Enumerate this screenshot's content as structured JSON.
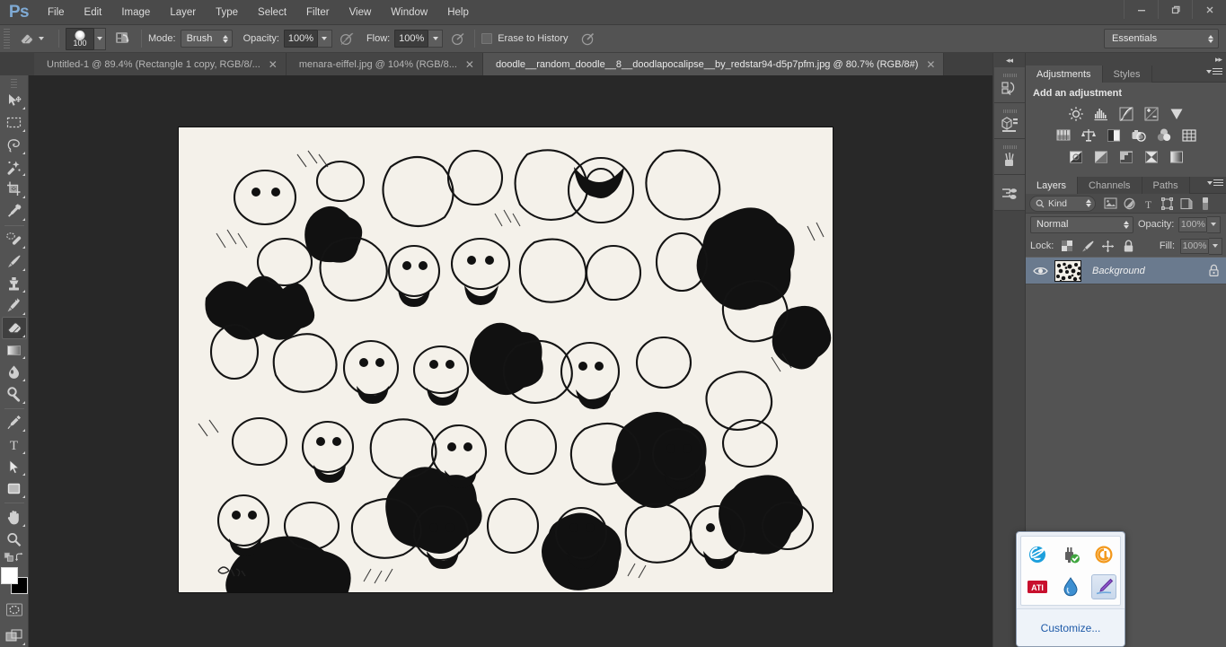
{
  "app": {
    "name": "Ps",
    "logo_color": "#7faad4",
    "workspace": "Essentials"
  },
  "menubar": {
    "items": [
      {
        "label": "File"
      },
      {
        "label": "Edit"
      },
      {
        "label": "Image"
      },
      {
        "label": "Layer"
      },
      {
        "label": "Type"
      },
      {
        "label": "Select"
      },
      {
        "label": "Filter"
      },
      {
        "label": "View"
      },
      {
        "label": "Window"
      },
      {
        "label": "Help"
      }
    ],
    "window_controls": [
      {
        "name": "minimize-button",
        "glyph": "—"
      },
      {
        "name": "restore-button",
        "glyph": "❐"
      },
      {
        "name": "close-button",
        "glyph": "✕"
      }
    ]
  },
  "options_bar": {
    "active_tool": "eraser-tool",
    "brush_size": "100",
    "mode_label": "Mode:",
    "mode_value": "Brush",
    "opacity_label": "Opacity:",
    "opacity_value": "100%",
    "flow_label": "Flow:",
    "flow_value": "100%",
    "erase_to_history_label": "Erase to History",
    "erase_to_history_checked": false
  },
  "tabs": [
    {
      "title": "Untitled-1 @ 89.4% (Rectangle 1 copy, RGB/8/...",
      "close": "✕",
      "active": false
    },
    {
      "title": "menara-eiffel.jpg @ 104% (RGB/8...",
      "close": "✕",
      "active": false
    },
    {
      "title": "doodle__random_doodle__8__doodlapocalipse__by_redstar94-d5p7pfm.jpg @ 80.7% (RGB/8#)",
      "close": "✕",
      "active": true
    }
  ],
  "toolbar": {
    "tools": [
      {
        "name": "move-tool",
        "has_flyout": true,
        "selected": false
      },
      {
        "name": "rectangular-marquee-tool",
        "has_flyout": true,
        "selected": false
      },
      {
        "name": "lasso-tool",
        "has_flyout": true,
        "selected": false
      },
      {
        "name": "quick-selection-tool",
        "has_flyout": true,
        "selected": false
      },
      {
        "name": "crop-tool",
        "has_flyout": true,
        "selected": false
      },
      {
        "name": "eyedropper-tool",
        "has_flyout": true,
        "selected": false
      },
      {
        "name": "spot-healing-brush-tool",
        "has_flyout": true,
        "selected": false
      },
      {
        "name": "brush-tool",
        "has_flyout": true,
        "selected": false
      },
      {
        "name": "clone-stamp-tool",
        "has_flyout": true,
        "selected": false
      },
      {
        "name": "history-brush-tool",
        "has_flyout": true,
        "selected": false
      },
      {
        "name": "eraser-tool",
        "has_flyout": true,
        "selected": true
      },
      {
        "name": "gradient-tool",
        "has_flyout": true,
        "selected": false
      },
      {
        "name": "blur-tool",
        "has_flyout": true,
        "selected": false
      },
      {
        "name": "dodge-tool",
        "has_flyout": true,
        "selected": false
      },
      {
        "name": "pen-tool",
        "has_flyout": true,
        "selected": false
      },
      {
        "name": "horizontal-type-tool",
        "has_flyout": true,
        "selected": false
      },
      {
        "name": "path-selection-tool",
        "has_flyout": true,
        "selected": false
      },
      {
        "name": "rectangle-tool",
        "has_flyout": true,
        "selected": false
      },
      {
        "name": "hand-tool",
        "has_flyout": true,
        "selected": false
      },
      {
        "name": "zoom-tool",
        "has_flyout": false,
        "selected": false
      }
    ],
    "foreground_color": "#ffffff",
    "background_color": "#000000"
  },
  "dock": {
    "items": [
      {
        "name": "history-panel-icon"
      },
      {
        "name": "mini-bridge-panel-icon"
      },
      {
        "name": "brush-panel-icon"
      },
      {
        "name": "clone-source-panel-icon"
      }
    ],
    "expand_glyph": "◂◂"
  },
  "adjustments_panel": {
    "tabs": [
      {
        "label": "Adjustments",
        "active": true
      },
      {
        "label": "Styles",
        "active": false
      }
    ],
    "title": "Add an adjustment",
    "icons": [
      {
        "name": "brightness-contrast-icon"
      },
      {
        "name": "levels-icon"
      },
      {
        "name": "curves-icon"
      },
      {
        "name": "exposure-icon"
      },
      {
        "name": "vibrance-icon"
      },
      {
        "name": "hue-saturation-icon"
      },
      {
        "name": "color-balance-icon"
      },
      {
        "name": "black-and-white-icon"
      },
      {
        "name": "photo-filter-icon"
      },
      {
        "name": "channel-mixer-icon"
      },
      {
        "name": "color-lookup-icon"
      },
      {
        "name": "invert-icon"
      },
      {
        "name": "posterize-icon"
      },
      {
        "name": "threshold-icon"
      },
      {
        "name": "selective-color-icon"
      },
      {
        "name": "gradient-map-icon"
      }
    ]
  },
  "layers_panel": {
    "tabs": [
      {
        "label": "Layers",
        "active": true
      },
      {
        "label": "Channels",
        "active": false
      },
      {
        "label": "Paths",
        "active": false
      }
    ],
    "filter_kind": "Kind",
    "filter_icons": [
      {
        "name": "filter-pixel-layers-icon"
      },
      {
        "name": "filter-adjustment-layers-icon"
      },
      {
        "name": "filter-type-layers-icon"
      },
      {
        "name": "filter-shape-layers-icon"
      },
      {
        "name": "filter-smart-object-icon"
      },
      {
        "name": "filter-toggle-icon"
      }
    ],
    "blend_mode": "Normal",
    "opacity_label": "Opacity:",
    "opacity_value": "100%",
    "lock_label": "Lock:",
    "lock_icons": [
      {
        "name": "lock-transparent-pixels-icon"
      },
      {
        "name": "lock-image-pixels-icon"
      },
      {
        "name": "lock-position-icon"
      },
      {
        "name": "lock-all-icon"
      }
    ],
    "fill_label": "Fill:",
    "fill_value": "100%",
    "layers": [
      {
        "name": "Background",
        "visible": true,
        "locked": true,
        "selected": true
      }
    ]
  },
  "tray_popup": {
    "icons": [
      {
        "name": "internet-explorer-icon",
        "color": "#2a9fd6"
      },
      {
        "name": "safely-remove-hardware-icon",
        "color": "#5b5b5b"
      },
      {
        "name": "amd-catalyst-icon",
        "color": "#f0920e"
      },
      {
        "name": "ati-icon",
        "color": "#c8102e"
      },
      {
        "name": "water-drop-icon",
        "color": "#2f7fc6"
      },
      {
        "name": "pen-tablet-icon",
        "color": "#8a5fd1",
        "highlighted": true
      }
    ],
    "customize_label": "Customize..."
  },
  "document": {
    "name": "doodle__random_doodle__8__doodlapocalipse__by_redstar94-d5p7pfm.jpg",
    "zoom": "80.7%",
    "color_mode": "RGB/8#",
    "artwork_description": "black-and-white ink doodle art collage of cartoon monsters"
  }
}
